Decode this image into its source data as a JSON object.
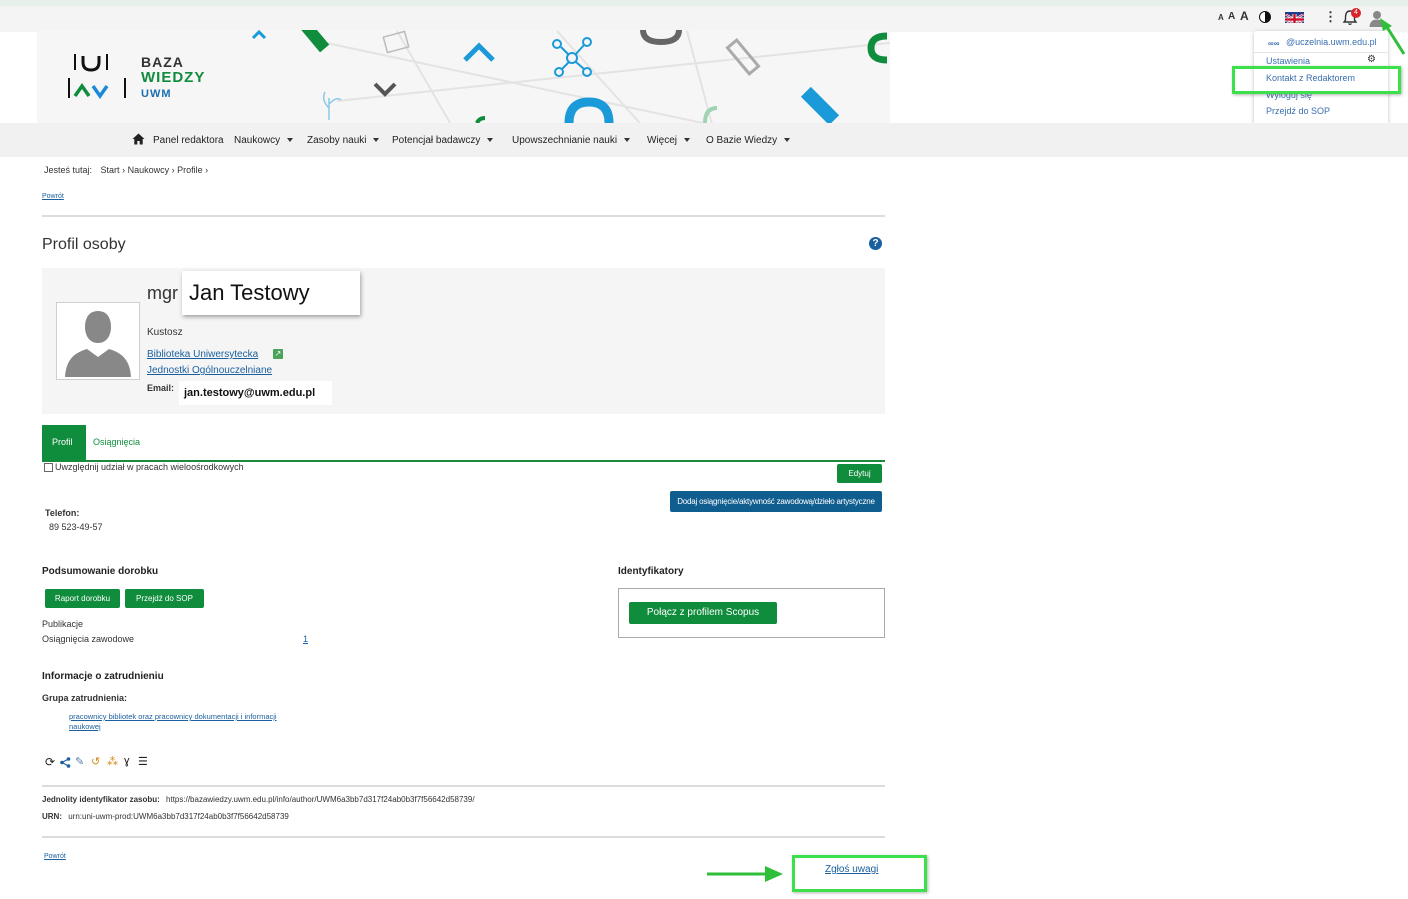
{
  "topbar": {
    "font_sizes": [
      "A",
      "A",
      "A"
    ],
    "notification_count": "4"
  },
  "user_menu": {
    "email": "@uczelnia.uwm.edu.pl",
    "items": [
      "Ustawienia",
      "Kontakt z Redaktorem",
      "Wyloguj się",
      "Przejdź do SOP"
    ]
  },
  "logo": {
    "line1": "BAZA",
    "line2": "WIEDZY",
    "line3": "UWM"
  },
  "nav": {
    "home": "Panel redaktora",
    "items": [
      "Naukowcy",
      "Zasoby nauki",
      "Potencjał badawczy",
      "Upowszechnianie nauki",
      "Więcej",
      "O Bazie Wiedzy"
    ]
  },
  "breadcrumb": {
    "prefix": "Jesteś tutaj:",
    "items": [
      "Start",
      "Naukowcy",
      "Profile"
    ]
  },
  "back_link": "Powrót",
  "page_title": "Profil osoby",
  "person": {
    "title": "mgr",
    "name": "Jan Testowy",
    "position": "Kustosz",
    "unit": "Biblioteka Uniwersytecka",
    "parent_unit": "Jednostki Ogólnouczelniane",
    "email_label": "Email:",
    "email": "jan.testowy@uwm.edu.pl"
  },
  "tabs": [
    "Profil",
    "Osiągnięcia"
  ],
  "checkbox_label": "Uwzględnij udział w pracach wieloośrodkowych",
  "buttons": {
    "edit": "Edytuj",
    "add_achievement": "Dodaj osiągnięcie/aktywność zawodową/dzieło artystyczne",
    "report": "Raport dorobku",
    "go_sop": "Przejdź do SOP",
    "scopus": "Połącz z profilem Scopus"
  },
  "phone": {
    "label": "Telefon:",
    "value": "89 523-49-57"
  },
  "summary": {
    "heading": "Podsumowanie dorobku",
    "publications_label": "Publikacje",
    "achievements_label": "Osiągnięcia zawodowe",
    "achievements_count": "1"
  },
  "identifiers": {
    "heading": "Identyfikatory"
  },
  "employment": {
    "heading": "Informacje o zatrudnieniu",
    "group_label": "Grupa zatrudnienia:",
    "group_line1": "pracownicy bibliotek oraz pracownicy dokumentacji i informacji",
    "group_line2": "naukowej"
  },
  "uri": {
    "label": "Jednolity identyfikator zasobu:",
    "value": "https://bazawiedzy.uwm.edu.pl/info/author/UWM6a3bb7d317f24ab0b3f7f56642d58739/"
  },
  "urn": {
    "label": "URN:",
    "value": "urn:uni-uwm-prod:UWM6a3bb7d317f24ab0b3f7f56642d58739"
  },
  "report_link": "Zgłoś uwagi",
  "colors": {
    "brand_green": "#0f8c3c",
    "brand_blue": "#1a5f9e",
    "highlight": "#3ce04a"
  }
}
